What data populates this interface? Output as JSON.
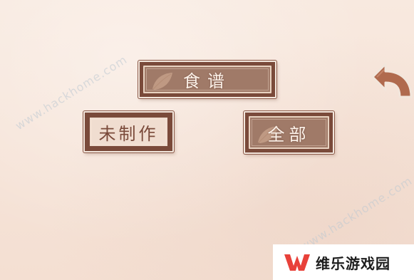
{
  "watermarks": [
    "www.hackhome.com",
    "www.hackhome.com"
  ],
  "menu": {
    "recipe_label": "食谱",
    "unmade_label": "未制作",
    "all_label": "全部"
  },
  "logo": {
    "text": "维乐游戏园",
    "brand_color": "#e8413a"
  },
  "colors": {
    "plaque_dark": "#7a4a3a",
    "plaque_fill": "#a07a68",
    "plaque_light_fill": "#f0ddd0",
    "background": "#f6e4d8",
    "back_arrow": "#b06a4e"
  },
  "icons": [
    "leaf-icon",
    "back-arrow-icon",
    "logo-w-icon"
  ]
}
